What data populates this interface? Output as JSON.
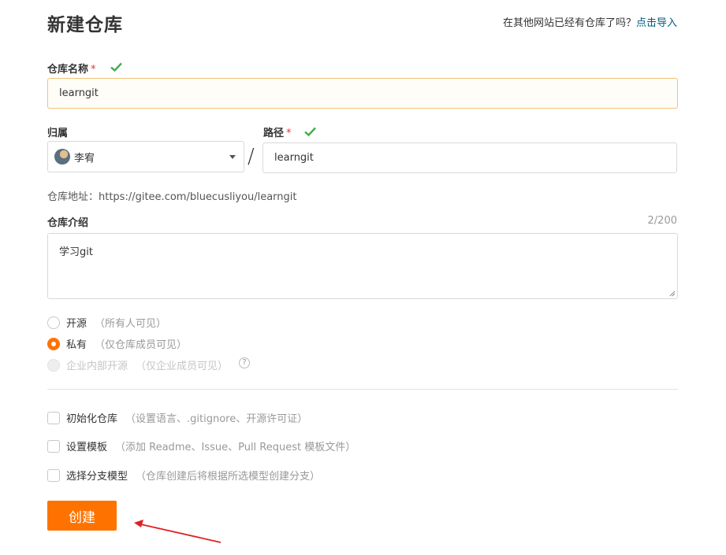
{
  "header": {
    "title": "新建仓库",
    "import_prompt": "在其他网站已经有仓库了吗？",
    "import_link": "点击导入"
  },
  "repo_name": {
    "label": "仓库名称",
    "required_mark": "*",
    "value": "learngit"
  },
  "owner": {
    "label": "归属",
    "value": "李宥"
  },
  "path": {
    "separator": "/",
    "label": "路径",
    "required_mark": "*",
    "value": "learngit"
  },
  "address": {
    "text": "仓库地址：https://gitee.com/bluecusliyou/learngit"
  },
  "description": {
    "label": "仓库介绍",
    "counter": "2/200",
    "value": "学习git"
  },
  "visibility": {
    "options": [
      {
        "label": "开源",
        "hint": "（所有人可见）",
        "checked": false,
        "disabled": false
      },
      {
        "label": "私有",
        "hint": "（仅仓库成员可见）",
        "checked": true,
        "disabled": false
      },
      {
        "label": "企业内部开源",
        "hint": "（仅企业成员可见）",
        "checked": false,
        "disabled": true
      }
    ],
    "help_glyph": "?"
  },
  "options": [
    {
      "label": "初始化仓库",
      "hint": "（设置语言、.gitignore、开源许可证）",
      "checked": false
    },
    {
      "label": "设置模板",
      "hint": "（添加 Readme、Issue、Pull Request 模板文件）",
      "checked": false
    },
    {
      "label": "选择分支模型",
      "hint": "（仓库创建后将根据所选模型创建分支）",
      "checked": false
    }
  ],
  "actions": {
    "create_label": "创建"
  },
  "colors": {
    "accent": "#fe7300",
    "link": "#005980",
    "valid": "#3fae49",
    "required": "#e5303c",
    "annotation_arrow": "#e02020"
  },
  "icons": [
    "check-icon",
    "avatar",
    "chevron-down-icon",
    "help-icon",
    "resize-handle-icon",
    "annotation-arrow"
  ]
}
